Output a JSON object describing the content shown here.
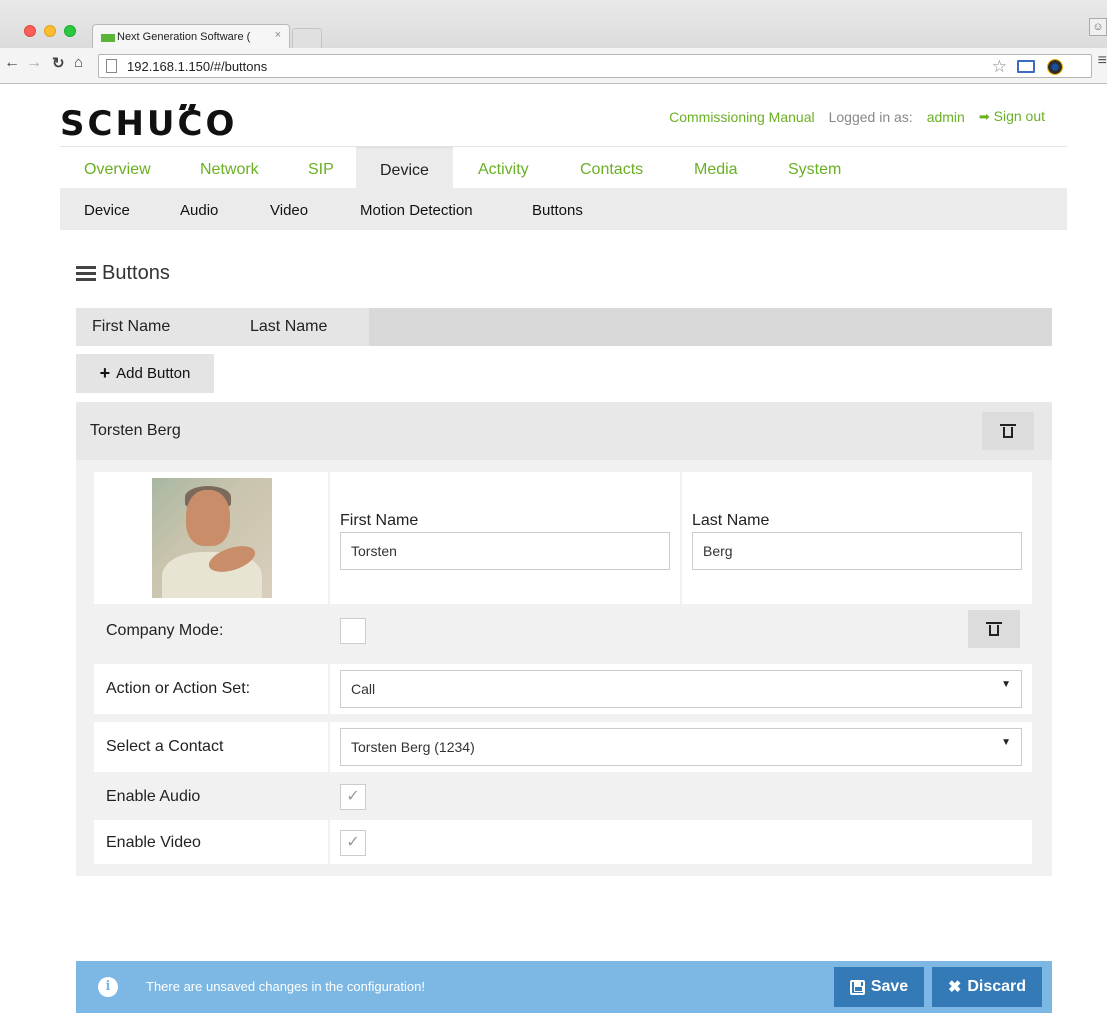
{
  "browser": {
    "tab_title": "Next Generation Software (",
    "tab_close": "×",
    "url": "192.168.1.150/#/buttons",
    "icons": [
      "back-icon",
      "forward-icon",
      "reload-icon",
      "home-icon",
      "page-icon",
      "star-icon",
      "cast-icon",
      "extension-icon",
      "menu-icon",
      "profile-icon"
    ]
  },
  "header": {
    "logo": "SCHUCO",
    "commissioning_manual": "Commissioning Manual",
    "logged_in_label": "Logged in as:",
    "user": "admin",
    "sign_out": "Sign out"
  },
  "main_nav": {
    "items": [
      "Overview",
      "Network",
      "SIP",
      "Device",
      "Activity",
      "Contacts",
      "Media",
      "System"
    ],
    "active": "Device"
  },
  "sub_nav": {
    "items": [
      "Device",
      "Audio",
      "Video",
      "Motion Detection",
      "Buttons"
    ]
  },
  "section": {
    "title": "Buttons",
    "columns": [
      "First Name",
      "Last Name"
    ],
    "add_button": "Add Button"
  },
  "entry": {
    "title": "Torsten Berg",
    "first_name_label": "First Name",
    "first_name_value": "Torsten",
    "last_name_label": "Last Name",
    "last_name_value": "Berg",
    "company_mode_label": "Company Mode:",
    "company_mode_checked": false,
    "action_label": "Action or Action Set:",
    "action_value": "Call",
    "contact_label": "Select a Contact",
    "contact_value": "Torsten Berg (1234)",
    "enable_audio_label": "Enable Audio",
    "enable_audio_checked": true,
    "enable_video_label": "Enable Video",
    "enable_video_checked": true
  },
  "alert": {
    "message": "There are unsaved changes in the configuration!",
    "save_label": "Save",
    "discard_label": "Discard"
  },
  "colors": {
    "brand_green": "#6ab023",
    "alert_blue": "#7db7e3",
    "button_blue": "#337ab7"
  }
}
